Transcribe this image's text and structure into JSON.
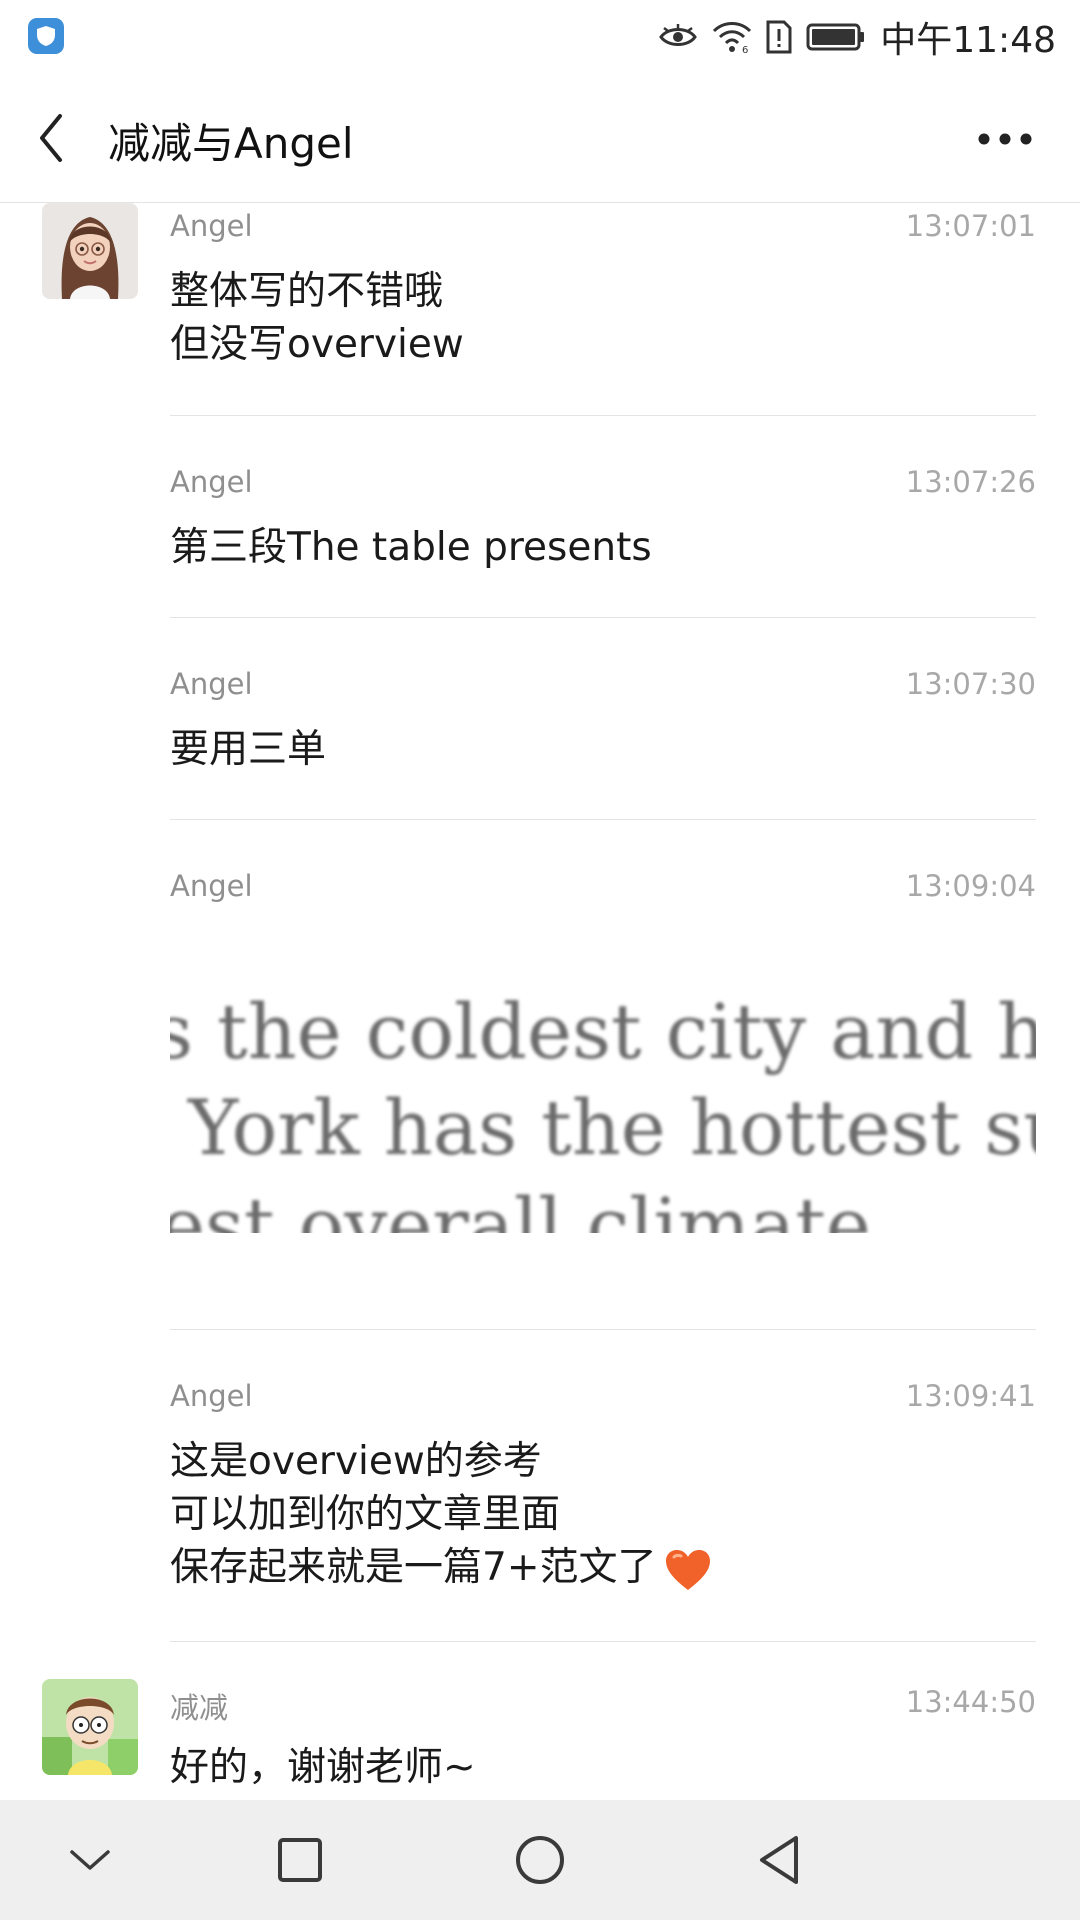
{
  "status_bar": {
    "time": "中午11:48",
    "icons": [
      "shield-app-icon",
      "eye-icon",
      "wifi-icon",
      "sim-alert-icon",
      "battery-icon"
    ]
  },
  "header": {
    "title": "减减与Angel",
    "back_icon": "chevron-left-icon",
    "more_icon": "more-dots-icon"
  },
  "messages": [
    {
      "sender": "Angel",
      "time": "13:07:01",
      "lines": [
        "整体写的不错哦",
        "但没写overview"
      ]
    },
    {
      "sender": "Angel",
      "time": "13:07:26",
      "lines": [
        "第三段The table presents"
      ]
    },
    {
      "sender": "Angel",
      "time": "13:07:30",
      "lines": [
        "要用三单"
      ]
    },
    {
      "sender": "Angel",
      "time": "13:09:04",
      "image_text": [
        "s the coldest city and has t",
        "York has the hottest sum",
        "est overall climate."
      ]
    },
    {
      "sender": "Angel",
      "time": "13:09:41",
      "lines": [
        "这是overview的参考",
        "可以加到你的文章里面",
        "保存起来就是一篇7+范文了"
      ]
    },
    {
      "sender": "减减",
      "time": "13:44:50",
      "lines": [
        "好的，谢谢老师~"
      ]
    }
  ],
  "nav_bar": {
    "icons": [
      "chevron-down-icon",
      "square-recents-icon",
      "circle-home-icon",
      "triangle-back-icon"
    ]
  },
  "colors": {
    "accent_shield": "#3c8fd8",
    "heart": "#f0622a",
    "nav_bg": "#efefef"
  }
}
